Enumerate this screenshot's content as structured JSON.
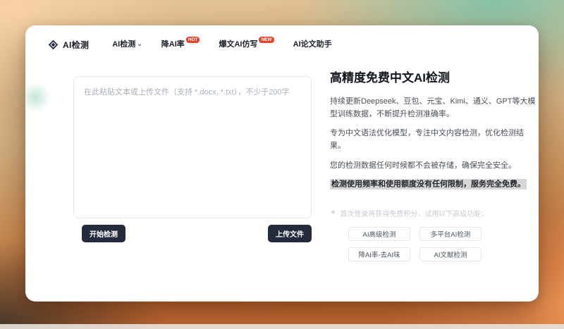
{
  "nav": {
    "brand_label": "AI检测",
    "items": [
      {
        "label": "AI检测",
        "has_dropdown": true
      },
      {
        "label": "降AI率",
        "badge": "HOT"
      },
      {
        "label": "爆文AI仿写",
        "badge": "NEW"
      },
      {
        "label": "AI论文助手"
      }
    ]
  },
  "editor": {
    "placeholder": "在此粘贴文本或上传文件（支持 *.docx, *.txt），不少于200字",
    "value": "",
    "start_button": "开始检测",
    "upload_button": "上传文件"
  },
  "intro": {
    "title": "高精度免费中文AI检测",
    "paragraphs": [
      "持续更新Deepseek、豆包、元宝、Kimi、通义、GPT等大模型训练数据，不断提升检测准确率。",
      "专为中文语法优化模型，专注中文内容检测，优化检测结果。",
      "您的检测数据任何时候都不会被存储，确保完全安全。"
    ],
    "highlight": "检测使用频率和使用额度没有任何限制，服务完全免费。",
    "tip": "首次登录将获得免费积分，试用以下高级功能：",
    "features": [
      "AI高级检测",
      "多平台AI检测",
      "降AI率-去AI味",
      "AI文献检测"
    ]
  },
  "icons": {
    "logo": "gem-icon",
    "nav_dropdown": "chevron-down-icon",
    "tip": "sparkle-icon"
  },
  "colors": {
    "primary_button": "#242b3a",
    "badge_red": "#e8432d",
    "highlight_bg": "#d7d7d7",
    "bg_top_right": "#86c3a9",
    "bg_top_left": "#f8d2a6",
    "bg_bottom": "#c66c35"
  }
}
